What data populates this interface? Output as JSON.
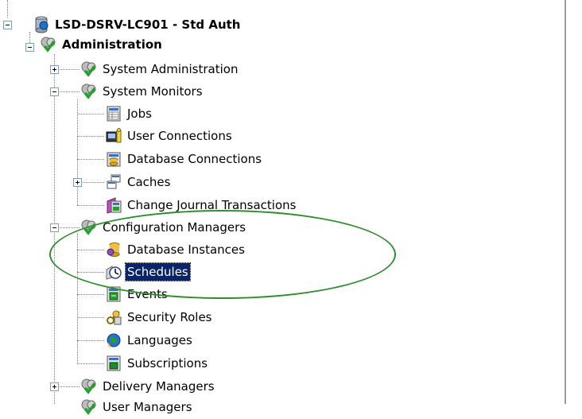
{
  "tree": {
    "server": {
      "label": "LSD-DSRV-LC901 - Std Auth",
      "icon": "server-icon"
    },
    "administration": {
      "label": "Administration",
      "icon": "gear-check-icon"
    },
    "system_administration": {
      "label": "System Administration",
      "icon": "gear-check-icon"
    },
    "system_monitors": {
      "label": "System Monitors",
      "icon": "gear-check-icon"
    },
    "jobs": {
      "label": "Jobs",
      "icon": "jobs-monitor-icon"
    },
    "user_connections": {
      "label": "User Connections",
      "icon": "user-connections-icon"
    },
    "database_connections": {
      "label": "Database Connections",
      "icon": "database-connections-icon"
    },
    "caches": {
      "label": "Caches",
      "icon": "caches-icon"
    },
    "change_journal": {
      "label": "Change Journal Transactions",
      "icon": "change-journal-icon"
    },
    "configuration_managers": {
      "label": "Configuration Managers",
      "icon": "gear-check-icon"
    },
    "database_instances": {
      "label": "Database Instances",
      "icon": "database-instances-icon"
    },
    "schedules": {
      "label": "Schedules",
      "icon": "schedules-clock-icon",
      "selected": true
    },
    "events": {
      "label": "Events",
      "icon": "events-icon"
    },
    "security_roles": {
      "label": "Security Roles",
      "icon": "security-roles-icon"
    },
    "languages": {
      "label": "Languages",
      "icon": "languages-globe-icon"
    },
    "subscriptions": {
      "label": "Subscriptions",
      "icon": "subscriptions-icon"
    },
    "delivery_managers": {
      "label": "Delivery Managers",
      "icon": "gear-check-icon"
    },
    "user_managers": {
      "label": "User Managers",
      "icon": "gear-check-icon"
    }
  },
  "annotation": {
    "color": "#2f8f2f"
  }
}
